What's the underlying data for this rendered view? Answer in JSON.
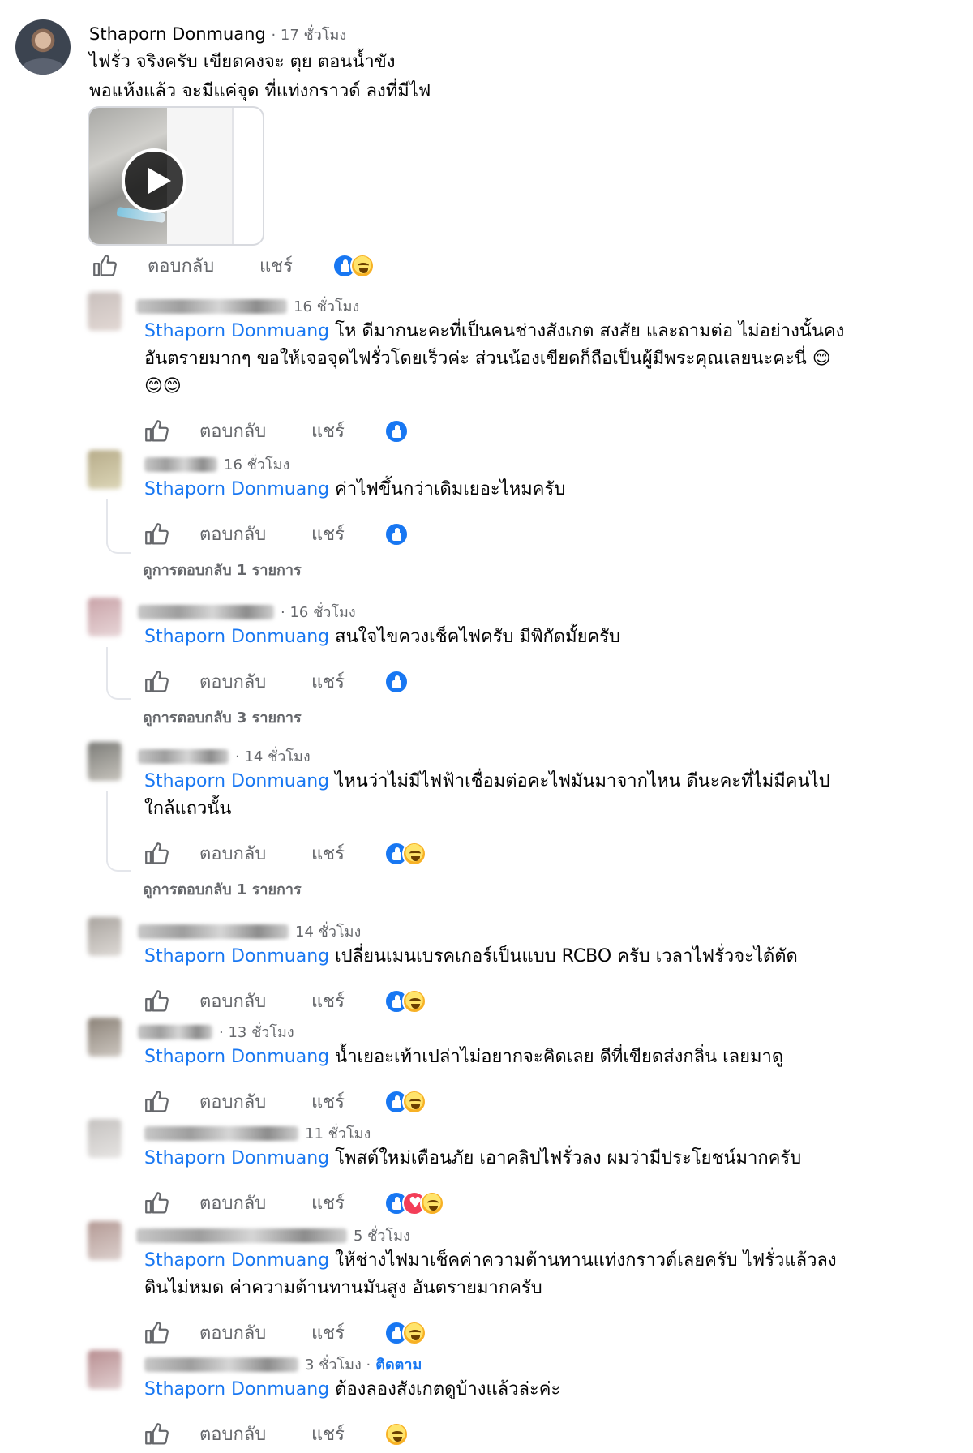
{
  "root": {
    "author": "Sthaporn Donmuang",
    "time": "17 ชั่วโมง",
    "text_lines": [
      "ไฟรั่ว จริงครับ เขียดคงจะ ตุย ตอนน้ำขัง",
      "พอแห้งแล้ว จะมีแค่จุด ที่แท่งกราวด์ ลงที่มีไฟ"
    ],
    "actions": {
      "reply": "ตอบกลับ",
      "share": "แชร์"
    },
    "reactions": [
      "like",
      "haha"
    ],
    "media_icon": "play-icon"
  },
  "comments": [
    {
      "time": "16 ชั่วโมง",
      "mention": "Sthaporn Donmuang",
      "text_lines": [
        "โห ดีมากนะคะที่เป็นคนช่างสังเกต สงสัย และถามต่อ ไม่อย่างนั้นคง",
        "อันตรายมากๆ ขอให้เจอจุดไฟรั่วโดยเร็วค่ะ ส่วนน้องเขียดก็ถือเป็นผู้มีพระคุณเลยนะคะนี่ 😊",
        "😊😊"
      ],
      "reply": "ตอบกลับ",
      "share": "แชร์",
      "reactions": [
        "like"
      ]
    },
    {
      "time": "16 ชั่วโมง",
      "mention": "Sthaporn Donmuang",
      "text_lines": [
        "ค่าไฟขึ้นกว่าเดิมเยอะไหมครับ"
      ],
      "reply": "ตอบกลับ",
      "share": "แชร์",
      "reactions": [
        "like"
      ],
      "view_replies": "ดูการตอบกลับ 1 รายการ"
    },
    {
      "time": "· 16 ชั่วโมง",
      "mention": "Sthaporn Donmuang",
      "text_lines": [
        "สนใจไขควงเช็คไฟครับ มีพิกัดมั้ยครับ"
      ],
      "reply": "ตอบกลับ",
      "share": "แชร์",
      "reactions": [
        "like"
      ],
      "view_replies": "ดูการตอบกลับ 3 รายการ"
    },
    {
      "time": "· 14 ชั่วโมง",
      "mention": "Sthaporn Donmuang",
      "text_lines": [
        "ไหนว่าไม่มีไฟฟ้าเชื่อมต่อคะไฟมันมาจากไหน ดีนะคะที่ไม่มีคนไป",
        "ใกล้แถวนั้น"
      ],
      "reply": "ตอบกลับ",
      "share": "แชร์",
      "reactions": [
        "like",
        "haha"
      ],
      "view_replies": "ดูการตอบกลับ 1 รายการ"
    },
    {
      "time": "14 ชั่วโมง",
      "mention": "Sthaporn Donmuang",
      "text_lines": [
        "เปลี่ยนเมนเบรคเกอร์เป็นแบบ RCBO ครับ เวลาไฟรั่วจะได้ตัด"
      ],
      "reply": "ตอบกลับ",
      "share": "แชร์",
      "reactions": [
        "like",
        "haha"
      ]
    },
    {
      "time": "· 13 ชั่วโมง",
      "mention": "Sthaporn Donmuang",
      "text_lines": [
        "น้ำเยอะเท้าเปล่าไม่อยากจะคิดเลย ดีที่เขียดส่งกลิ่น เลยมาดู"
      ],
      "reply": "ตอบกลับ",
      "share": "แชร์",
      "reactions": [
        "like",
        "haha"
      ]
    },
    {
      "time": "11 ชั่วโมง",
      "mention": "Sthaporn Donmuang",
      "text_lines": [
        "โพสต์ใหม่เตือนภัย เอาคลิปไฟรั่วลง ผมว่ามีประโยชน์มากครับ"
      ],
      "reply": "ตอบกลับ",
      "share": "แชร์",
      "reactions": [
        "like",
        "love",
        "haha"
      ]
    },
    {
      "time": "5 ชั่วโมง",
      "mention": "Sthaporn Donmuang",
      "text_lines": [
        "ให้ช่างไฟมาเช็คค่าความต้านทานแท่งกราวด์เลยครับ ไฟรั่วแล้วลง",
        "ดินไม่หมด ค่าความต้านทานมันสูง อันตรายมากครับ"
      ],
      "reply": "ตอบกลับ",
      "share": "แชร์",
      "reactions": [
        "like",
        "haha"
      ]
    },
    {
      "time": "3 ชั่วโมง ·",
      "follow": "ติดตาม",
      "mention": "Sthaporn Donmuang",
      "text_lines": [
        "ต้องลองสังเกตดูบ้างแล้วล่ะค่ะ"
      ],
      "reply": "ตอบกลับ",
      "share": "แชร์",
      "reactions": [
        "haha"
      ]
    }
  ],
  "colors": {
    "mention": "#1877f2",
    "secondary_text": "#65676b",
    "like_blue": "#1877f2",
    "love_red": "#f33e58",
    "haha_yellow": "#f7b125"
  }
}
